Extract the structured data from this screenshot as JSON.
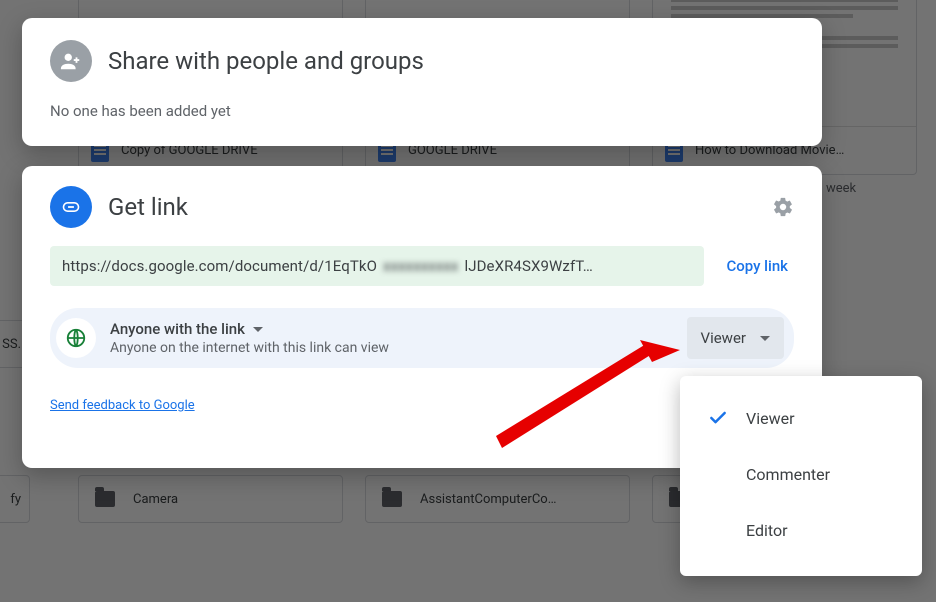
{
  "bg": {
    "doc1": "Copy of GOOGLE DRIVE",
    "doc2": "GOOGLE DRIVE",
    "doc3": "How to Download Movie…",
    "doc3_sub": "week",
    "folder1": "Camera",
    "folder2": "AssistantComputerCo…",
    "ss": "SS.",
    "fy": "fy"
  },
  "share": {
    "title": "Share with people and groups",
    "subtitle": "No one has been added yet"
  },
  "link": {
    "title": "Get link",
    "url_prefix": "https://docs.google.com/document/d/1EqTkO",
    "url_suffix": "lJDeXR4SX9WzfT…",
    "copy": "Copy link",
    "scope_title": "Anyone with the link",
    "scope_sub": "Anyone on the internet with this link can view",
    "role": "Viewer",
    "feedback": "Send feedback to Google"
  },
  "menu": {
    "viewer": "Viewer",
    "commenter": "Commenter",
    "editor": "Editor"
  }
}
